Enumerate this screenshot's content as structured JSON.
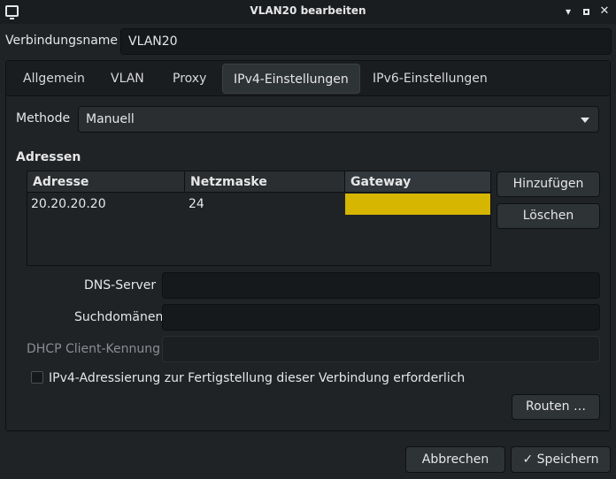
{
  "window": {
    "title": "VLAN20 bearbeiten",
    "controls": [
      "▾",
      "▴",
      "✕"
    ]
  },
  "connection": {
    "name_label": "Verbindungsname",
    "name_value": "VLAN20"
  },
  "tabs": [
    {
      "label": "Allgemein",
      "active": false
    },
    {
      "label": "VLAN",
      "active": false
    },
    {
      "label": "Proxy",
      "active": false
    },
    {
      "label": "IPv4-Einstellungen",
      "active": true
    },
    {
      "label": "IPv6-Einstellungen",
      "active": false
    }
  ],
  "ipv4": {
    "method_label": "Methode",
    "method_value": "Manuell",
    "addresses_heading": "Adressen",
    "columns": [
      "Adresse",
      "Netzmaske",
      "Gateway"
    ],
    "rows": [
      {
        "address": "20.20.20.20",
        "netmask": "24",
        "gateway": ""
      }
    ],
    "editing_cell_color": "#d6b600",
    "add_button": "Hinzufügen",
    "delete_button": "Löschen",
    "dns_label": "DNS-Server",
    "dns_value": "",
    "search_domains_label": "Suchdomänen",
    "search_domains_value": "",
    "dhcp_client_id_label": "DHCP Client-Kennung",
    "dhcp_client_id_value": "",
    "require_ipv4_label": "IPv4-Adressierung zur Fertigstellung dieser Verbindung erforderlich",
    "require_ipv4_checked": false,
    "routes_button": "Routen …"
  },
  "footer": {
    "cancel_button": "Abbrechen",
    "save_button": "Speichern",
    "save_icon": "check-icon"
  }
}
